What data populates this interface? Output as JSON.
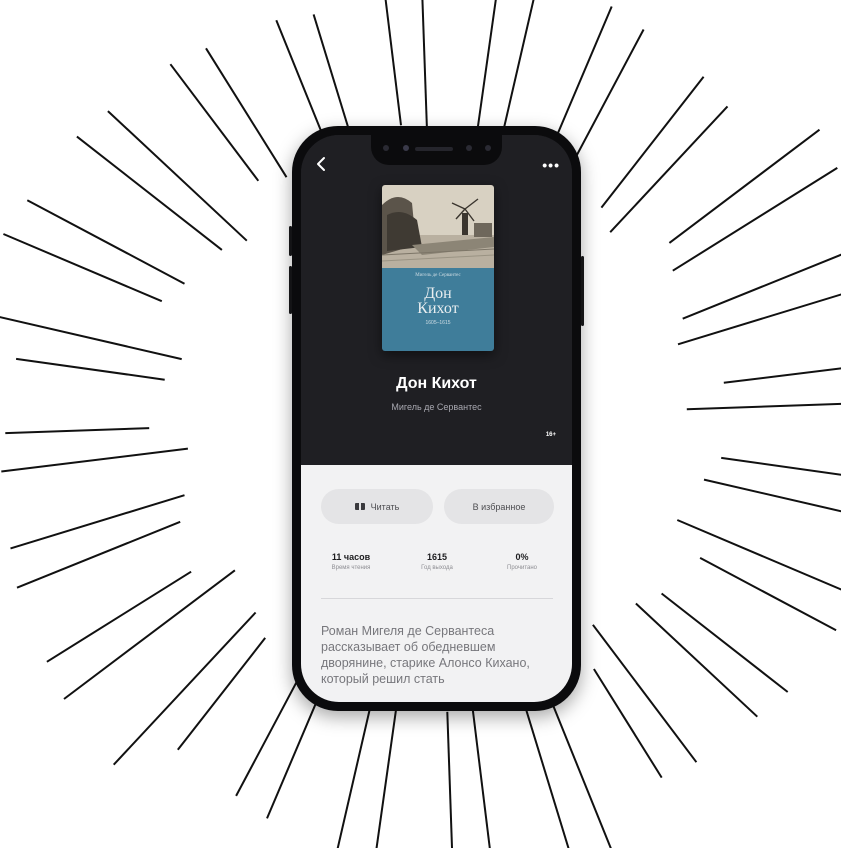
{
  "book": {
    "title": "Дон Кихот",
    "author": "Мигель де Сервантес",
    "age_rating": "16+",
    "cover": {
      "title_line1": "Дон",
      "title_line2": "Кихот",
      "author": "Мигель де Сервантес",
      "subtitle": "1605–1615"
    }
  },
  "nav": {
    "back_icon": "chevron-left-icon",
    "more_label": "•••"
  },
  "actions": {
    "read_label": "Читать",
    "favorite_label": "В избранное"
  },
  "stats": [
    {
      "value": "11 часов",
      "label": "Время чтения"
    },
    {
      "value": "1615",
      "label": "Год выхода"
    },
    {
      "value": "0%",
      "label": "Прочитано"
    }
  ],
  "description": "Роман Мигеля де Сервантеса рассказывает об обедневшем дворянине, старике Алонсо Кихано, который решил стать",
  "colors": {
    "hero_background": "#1f1f23",
    "sheet_background": "#f2f2f3",
    "cover_panel": "#3f7d9a",
    "rays": "#111111"
  }
}
